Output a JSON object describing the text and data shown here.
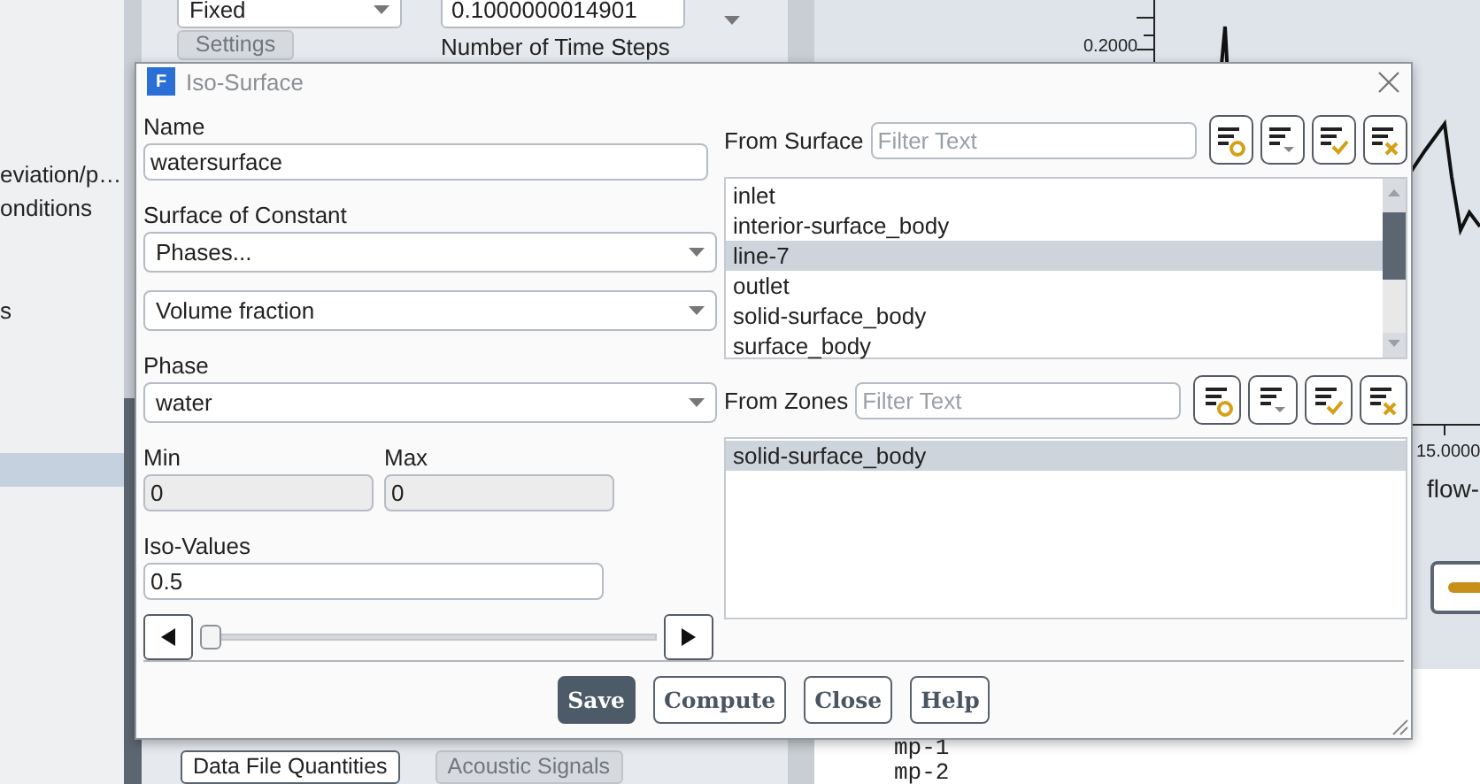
{
  "tree_panel": {
    "items": [
      {
        "label": "eviation/p…",
        "selected": false
      },
      {
        "label": "onditions",
        "selected": false
      },
      {
        "label": "s",
        "selected": false
      },
      {
        "selected": true
      }
    ]
  },
  "run_panel": {
    "time_step_method": "Fixed",
    "settings_button": "Settings",
    "time_step_size": "0.1000000014901",
    "time_steps_label": "Number of Time Steps",
    "buttons": [
      {
        "label": "Data File Quantities",
        "disabled": false
      },
      {
        "label": "Acoustic Signals",
        "disabled": true
      }
    ]
  },
  "plot": {
    "y_tick_label": "0.2000",
    "x_tick_label": "15.0000",
    "x_axis_title": "flow-"
  },
  "console": {
    "lines": [
      "mp-1",
      "mp-2"
    ]
  },
  "dialog": {
    "logo_letter": "F",
    "title": "Iso-Surface",
    "name": {
      "label": "Name",
      "value": "watersurface"
    },
    "surface_of_constant": {
      "label": "Surface of Constant",
      "value": "Phases..."
    },
    "quantity": {
      "value": "Volume fraction"
    },
    "phase": {
      "label": "Phase",
      "value": "water"
    },
    "min": {
      "label": "Min",
      "value": "0"
    },
    "max": {
      "label": "Max",
      "value": "0"
    },
    "iso_values": {
      "label": "Iso-Values",
      "value": "0.5",
      "level": 0
    },
    "from_surface": {
      "label": "From Surface",
      "placeholder": "Filter Text",
      "items": [
        {
          "label": "inlet",
          "selected": false
        },
        {
          "label": "interior-surface_body",
          "selected": false
        },
        {
          "label": "line-7",
          "selected": true
        },
        {
          "label": "outlet",
          "selected": false
        },
        {
          "label": "solid-surface_body",
          "selected": false
        },
        {
          "label": "surface_body",
          "selected": false
        }
      ]
    },
    "from_zones": {
      "label": "From Zones",
      "placeholder": "Filter Text",
      "items": [
        {
          "label": "solid-surface_body",
          "selected": true
        }
      ]
    },
    "buttons": [
      {
        "label": "Save",
        "kind": "primary"
      },
      {
        "label": "Compute",
        "kind": "default"
      },
      {
        "label": "Close",
        "kind": "default"
      },
      {
        "label": "Help",
        "kind": "default"
      }
    ]
  }
}
